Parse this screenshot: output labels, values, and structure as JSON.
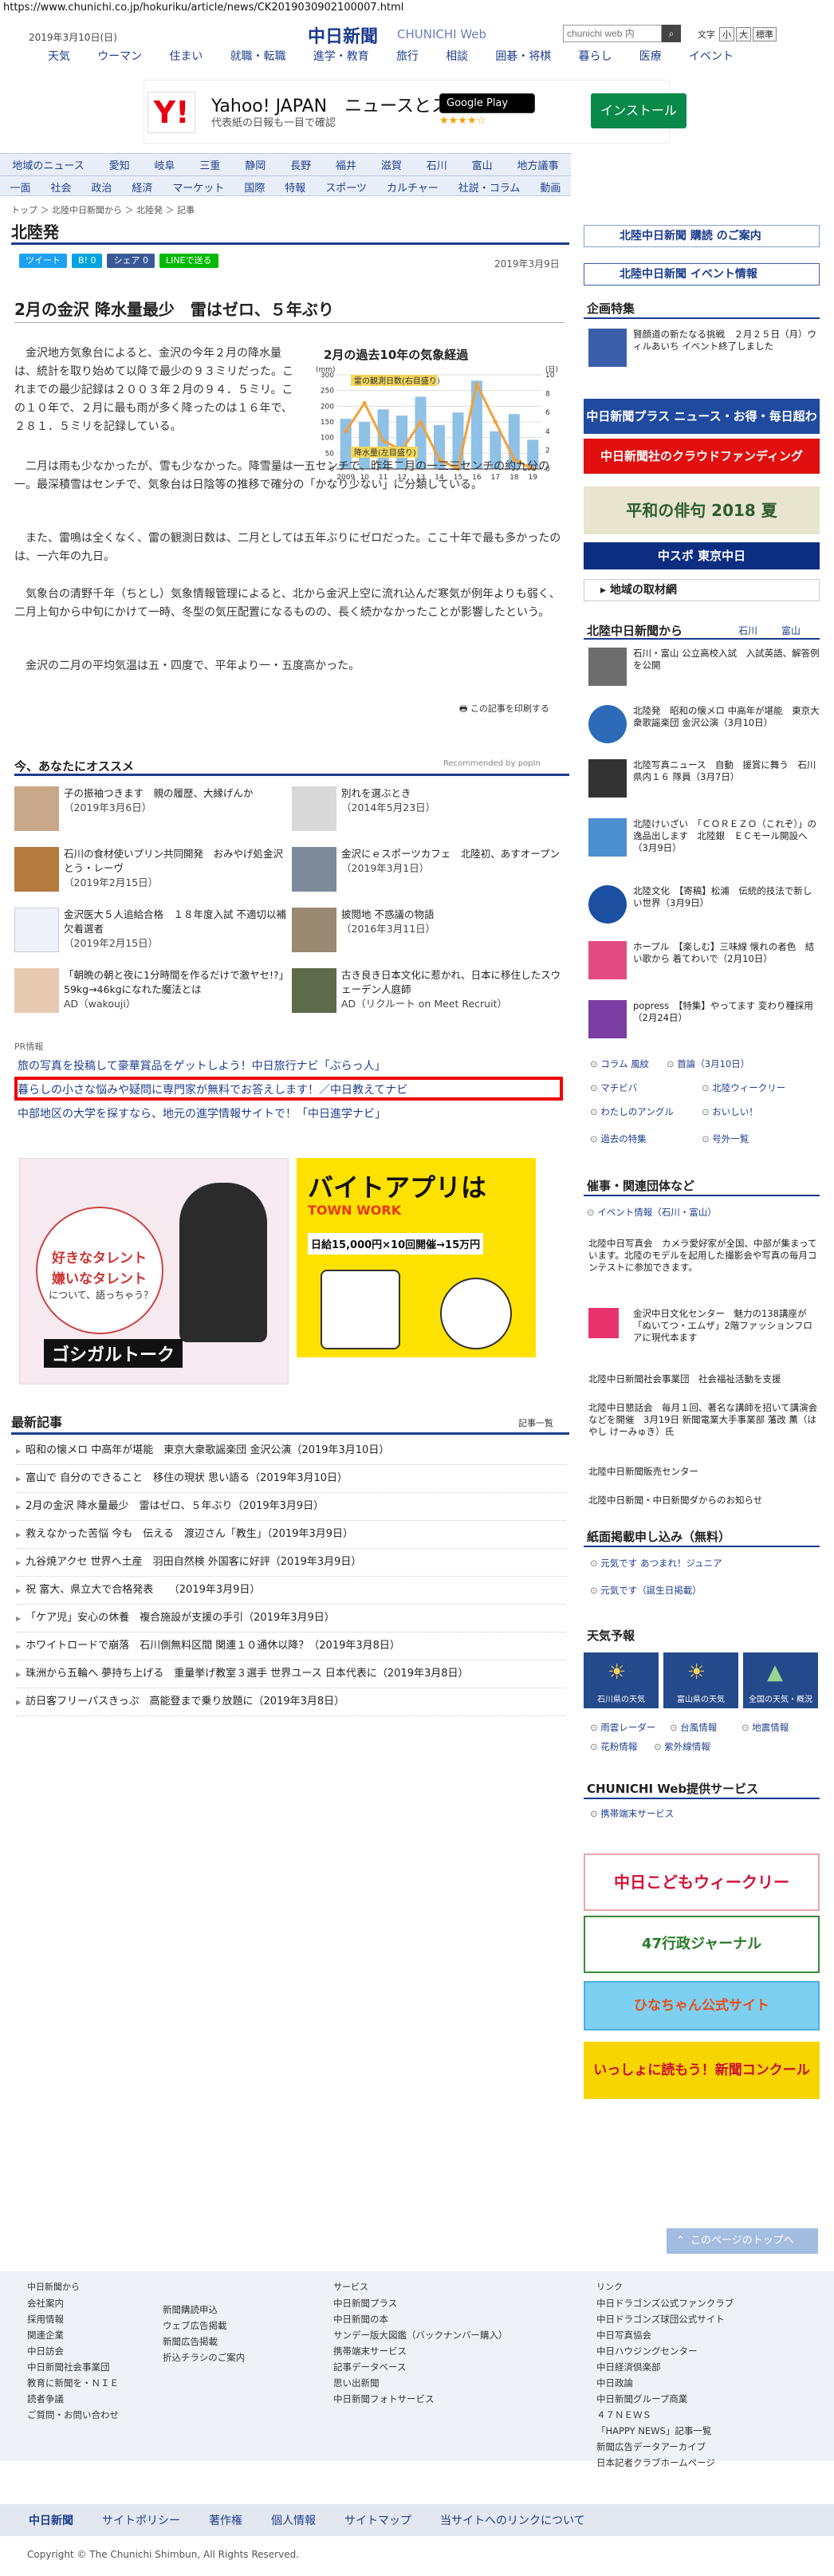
{
  "url": "https://www.chunichi.co.jp/hokuriku/article/news/CK2019030902100007.html",
  "header": {
    "date": "2019年3月10日(日)",
    "logo": "中日新聞",
    "logo_sub": "CHUNICHI Web",
    "search_placeholder": "chunichi web 内",
    "search_btn": "検索",
    "font_label": "文字",
    "font_buttons": [
      "小",
      "大",
      "標準"
    ],
    "topnav": [
      "天気",
      "ウーマン",
      "住まい",
      "就職・転職",
      "進学・教育",
      "旅行",
      "相談",
      "囲碁・将棋",
      "暮らし",
      "医療",
      "イベント"
    ]
  },
  "ad_top": {
    "logo": "Y!",
    "title": "Yahoo! JAPAN　ニュースとスポ…",
    "desc": "代表紙の日報も一目で確認",
    "store": "Google Play",
    "rating": "★★★★☆",
    "cta": "インストール"
  },
  "regnav": {
    "row1": [
      "地域のニュース",
      "愛知",
      "岐阜",
      "三重",
      "静岡",
      "長野",
      "福井",
      "滋賀",
      "石川",
      "富山",
      "地方議事"
    ],
    "row2": [
      "一面",
      "社会",
      "政治",
      "経済",
      "マーケット",
      "国際",
      "特報",
      "スポーツ",
      "カルチャー",
      "社説・コラム",
      "動画"
    ]
  },
  "breadcrumb": "トップ ＞ 北陸中日新聞から ＞ 北陸発 ＞ 記事",
  "section_title": "北陸発",
  "social": [
    "ツイート",
    "B! 0",
    "シェア 0",
    "LINEで送る"
  ],
  "article": {
    "date": "2019年3月9日",
    "title": "2月の金沢 降水量最少　雷はゼロ、５年ぶり",
    "p1": "金沢地方気象台によると、金沢の今年２月の降水量は、統計を取り始めて以降で最少の９３ミリだった。これまでの最少記録は２００３年２月の９４．５ミリ。この１０年で、２月に最も雨が多く降ったのは１６年で、２８１．５ミリを記録している。",
    "p2": "二月は雨も少なかったが、雪も少なかった。降雪量は一五センチで、昨年二月の一三三センチの約九分の一。最深積雪はセンチで、気象台は日陰等の推移で確分の「かなり少ない」に分類している。",
    "p3": "また、雷鳴は全くなく、雷の観測日数は、二月としては五年ぶりにゼロだった。ここ十年で最も多かったのは、一六年の九日。",
    "p4": "気象台の清野千年（ちとし）気象情報管理によると、北から金沢上空に流れ込んだ寒気が例年よりも弱く、二月上旬から中旬にかけて一時、冬型の気圧配置になるものの、長く続かなかったことが影響したという。",
    "p5": "金沢の二月の平均気温は五・四度で、平年より一・五度高かった。",
    "print": "この記事を印刷する"
  },
  "chart_data": {
    "type": "bar",
    "title": "2月の過去10年の気象経過",
    "categories": [
      "2009",
      "10",
      "11",
      "12",
      "13",
      "14",
      "15",
      "16",
      "17",
      "18",
      "19"
    ],
    "series": [
      {
        "name": "降水量(左目盛り)",
        "values": [
          160,
          150,
          190,
          170,
          230,
          140,
          180,
          281.5,
          120,
          175,
          93
        ]
      },
      {
        "name": "雷の観測日数(右目盛り)",
        "values": [
          4,
          7,
          3,
          2,
          5,
          1,
          0,
          9,
          5,
          1,
          0
        ]
      }
    ],
    "left_axis_unit": "(mm)",
    "right_axis_unit": "(日)",
    "ylim_left": [
      0,
      300
    ],
    "ylim_right": [
      0,
      10
    ],
    "left_ticks": [
      "300",
      "250",
      "200",
      "150",
      "100",
      "50",
      "0"
    ],
    "right_ticks": [
      "10",
      "8",
      "6",
      "4",
      "2",
      "0"
    ],
    "colors": {
      "bar": "#8fc1e6",
      "line": "#f2a13a",
      "highlight": "#f2d75a"
    }
  },
  "recommend": {
    "heading": "今、あなたにオススメ",
    "powered": "Recommended by popIn",
    "items": [
      {
        "text": "子の振袖つきます　親の履歴、大縁げんか",
        "date": "（2019年3月6日）"
      },
      {
        "text": "別れを選ぶとき",
        "date": "（2014年5月23日）"
      },
      {
        "text": "石川の食材使いプリン共同開発　おみやげ処金沢とう・レーヴ",
        "date": "（2019年2月15日）"
      },
      {
        "text": "金沢にｅスポーツカフェ　北陸初、あすオープン",
        "date": "（2019年3月1日）"
      },
      {
        "text": "金沢医大５人追給合格　１８年度入試 不適切以補欠着選者",
        "date": "（2019年2月15日）"
      },
      {
        "text": "披閲地 不惑議の物語",
        "date": "（2016年3月11日）"
      },
      {
        "text": "「朝晩の朝と夜に1分時間を作るだけで激ヤセ!?」59kg→46kgになれた魔法とは",
        "date": "AD（wakouji）"
      },
      {
        "text": "古き良き日本文化に惹かれ、日本に移住したスウェーデン人庭師",
        "date": "AD（リクルート on Meet Recruit）"
      }
    ]
  },
  "pr": {
    "label": "PR情報",
    "links": [
      "旅の写真を投稿して豪華賞品をゲットしよう！中日旅行ナビ「ぶらっ人」",
      "暮らしの小さな悩みや疑問に専門家が無料でお答えします！／中日教えてナビ",
      "中部地区の大学を探すなら、地元の進学情報サイトで！「中日進学ナビ」"
    ]
  },
  "big_ads": {
    "ad1_line1": "好きなタレント",
    "ad1_line2": "嫌いなタレント",
    "ad1_line3": "について、語っちゃう？",
    "ad1_footer": "ゴシガルトーク",
    "ad2_title": "バイトアプリは",
    "ad2_brand": "TOWN WORK",
    "ad2_price": "日給15,000円×10回開催→15万円"
  },
  "latest": {
    "heading": "最新記事",
    "more": "記事一覧",
    "items": [
      "昭和の懐メロ 中高年が堪能　東京大衆歌謡楽団 金沢公演（2019年3月10日）",
      "富山で 自分のできること　移住の現状 思い語る（2019年3月10日）",
      "2月の金沢 降水量最少　雷はゼロ、５年ぶり（2019年3月9日）",
      "救えなかった苦悩 今も　伝える　渡辺さん「教生」（2019年3月9日）",
      "九谷焼アクセ 世界へ土産　羽田自然検 外国客に好評（2019年3月9日）",
      "祝 富大、県立大で合格発表　　（2019年3月9日）",
      "「ケア児」安心の休養　複合施設が支援の手引（2019年3月9日）",
      "ホワイトロードで崩落　石川側無料区間 関連１０通休以降？（2019年3月8日）",
      "珠洲から五輪へ 夢持ち上げる　重量挙げ教室３選手 世界ユース 日本代表に（2019年3月8日）",
      "訪日客フリーパスきっぷ　高能登まで乗り放題に（2019年3月8日）"
    ]
  },
  "right": {
    "btn1": "北陸中日新聞 購読 のご案内",
    "btn2": "北陸中日新聞 イベント情報",
    "kikaku": "企画特集",
    "kikaku_item": "賢顔道の新たなる挑戦　２月２５日（月）ウィルあいち イベント終了しました",
    "ad_plus": "中日新聞プラス ニュース・お得・毎日超わくわく",
    "ad_cf": "中日新聞社のクラウドファンディング",
    "ad_haiku": "平和の俳句 2018 夏",
    "ad_chuspo": "中スポ 東京中日",
    "local": "地域の取材網",
    "hokuriku_head": "北陸中日新聞から",
    "hokuriku_tabs": [
      "石川",
      "富山"
    ],
    "hokuriku_items": [
      "石川・富山 公立高校入試　入試英語、解答例を公開",
      "北陸発　昭和の懐メロ 中高年が堪能　東京大衆歌謡楽団 金沢公演（3月10日）",
      "北陸写真ニュース　自動　援賞に舞う　石川県内１６ 隊員（3月7日）",
      "北陸けいざい　「ＣＯＲＥＺＯ（これぞ）」の逸品出します　北陸銀　ＥＣモール開設へ（3月9日）",
      "北陸文化　【寄稿】松浦　伝統的技法で新しい世界（3月9日）",
      "ホープル　【楽しむ】三味線 懐れの者色　結い歌から 着てわいで（2月10日）",
      "popress　【特集】やってます 変わり種採用（2月24日）"
    ],
    "links_col1": [
      "コラム 風紋",
      "マチビバ",
      "わたしのアングル",
      "過去の特集"
    ],
    "links_col2": [
      "首論（3月10日）",
      "北陸ウィークリー",
      "おいしい！",
      "号外一覧"
    ],
    "events_head": "催事・関連団体など",
    "events_link": "イベント情報（石川・富山）",
    "events": [
      "北陸中日写真会　カメラ愛好家が全国、中部が集まっています。北陸のモデルを起用した撮影会や写真の毎月コンテストに参加できます。",
      "金沢中日文化センター　魅力の138講座が「ぬいてつ・エムザ」2階ファッションフロアに現代本ます",
      "北陸中日新聞社会事業団　社会福祉活動を支援",
      "北陸中日懇話会　毎月１回、著名な講師を招いて講演会などを開催　3月19日 新聞電業大手事業部 藩改 薫（はやし けーみゅき）氏",
      "北陸中日新聞販売センター",
      "北陸中日新聞・中日新聞ダからのお知らせ"
    ],
    "kiji_head": "紙面掲載申し込み（無料）",
    "kiji_links": [
      "元気です あつまれ！ジュニア",
      "元気です（誕生日掲載）"
    ],
    "weather_head": "天気予報",
    "weather_tiles": [
      "石川県の天気",
      "富山県の天気",
      "全国の天気・概況"
    ],
    "weather_links": [
      "雨雲レーダー",
      "台風情報",
      "地震情報",
      "花粉情報",
      "紫外線情報"
    ],
    "service_head": "CHUNICHI Web提供サービス",
    "service_link": "携帯端末サービス",
    "bottom_ads": [
      "中日こどもウィークリー",
      "47行政ジャーナル",
      "ひなちゃん公式サイト",
      "いっしょに読もう！新聞コンクール"
    ]
  },
  "back_to_top": "このページのトップへ",
  "footer": {
    "col1_head": "中日新聞から",
    "col1": [
      "会社案内",
      "採用情報",
      "関連企業",
      "中日訪会",
      "中日新聞社会事業団",
      "教育に新聞を・ＮＩＥ",
      "読者争議",
      "ご質問・お問い合わせ"
    ],
    "col2": [
      "新聞購読申込",
      "ウェブ広告掲載",
      "新聞広告掲載",
      "折込チラシのご案内"
    ],
    "col3_head": "サービス",
    "col3": [
      "中日新聞プラス",
      "中日新聞の本",
      "サンデー版大図鑑（バックナンバー購入）",
      "携帯端末サービス",
      "記事データベース",
      "思い出新聞",
      "中日新聞フォトサービス"
    ],
    "col4_head": "リンク",
    "col4": [
      "中日ドラゴンズ公式ファンクラブ",
      "中日ドラゴンズ球団公式サイト",
      "中日写真協会",
      "中日ハウジングセンター",
      "中日経済倶楽部",
      "中日政論",
      "中日新聞グループ商業",
      "４７ＮＥＷＳ",
      "「HAPPY NEWS」記事一覧",
      "新聞広告データアーカイブ",
      "日本記者クラブホームページ"
    ],
    "bar": [
      "中日新聞",
      "サイトポリシー",
      "著作権",
      "個人情報",
      "サイトマップ",
      "当サイトへのリンクについて"
    ],
    "copyright": "Copyright © The Chunichi Shimbun, All Rights Reserved."
  }
}
